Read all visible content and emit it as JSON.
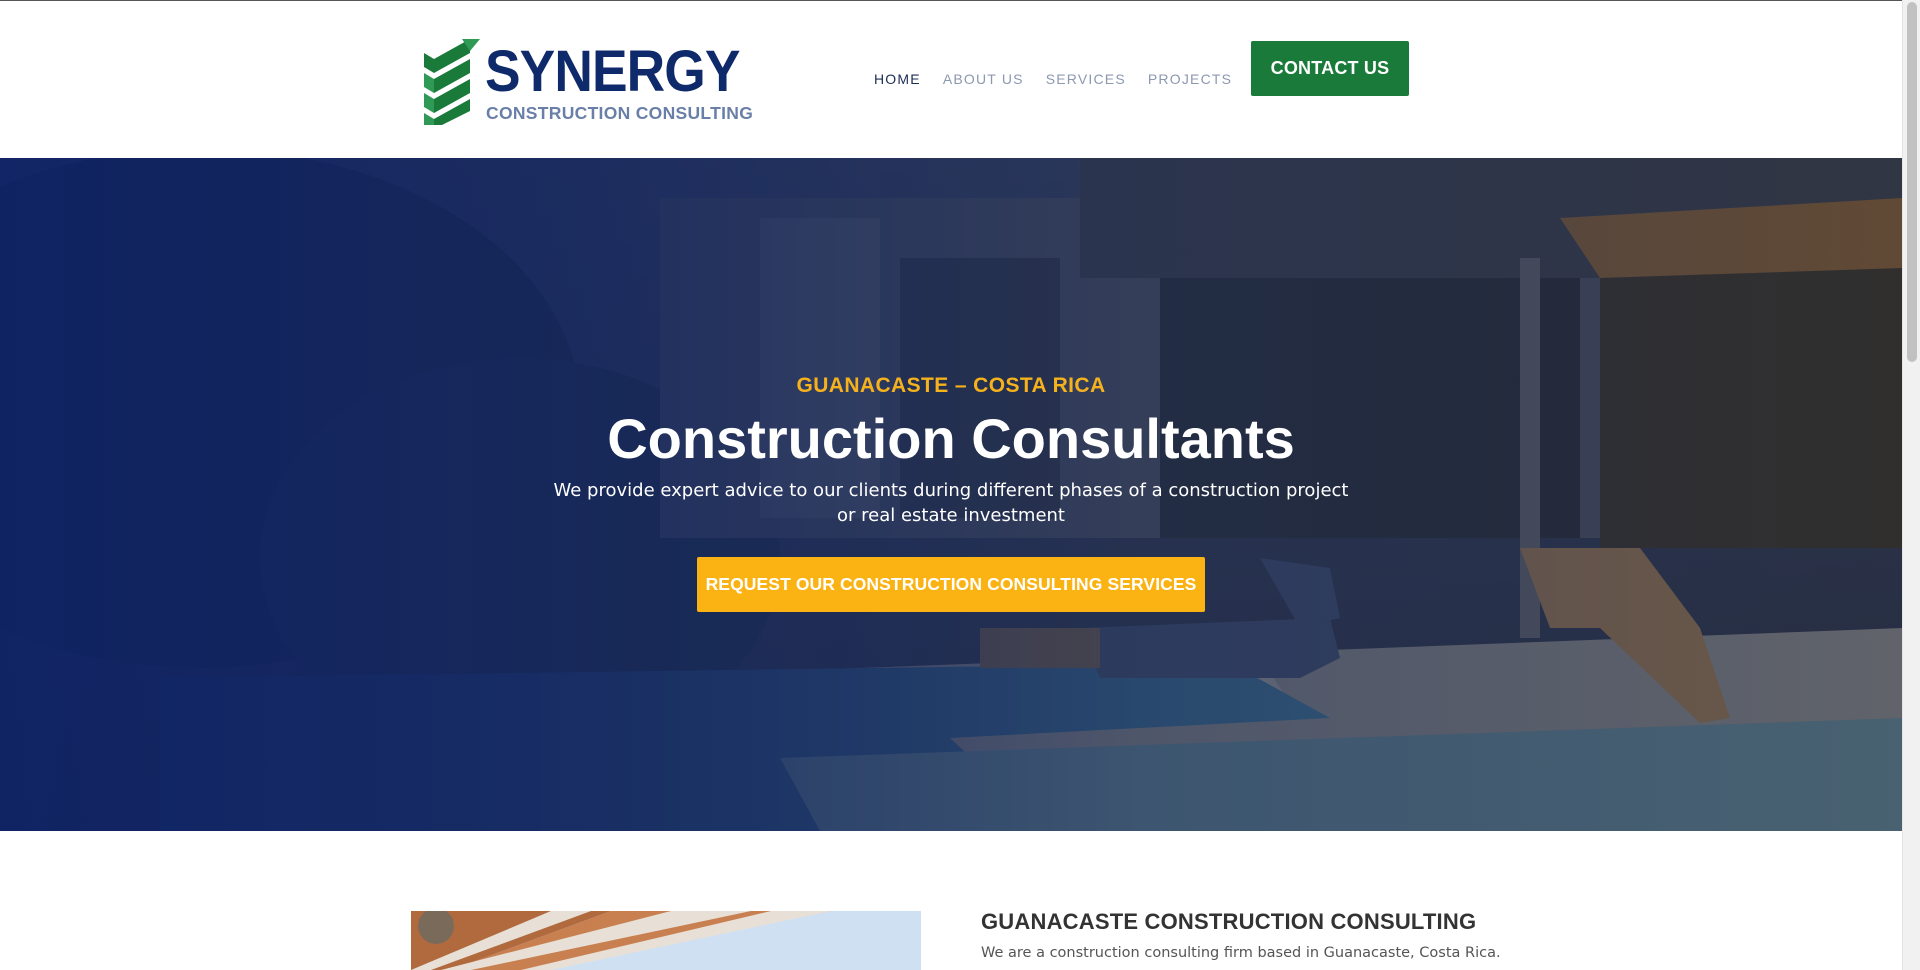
{
  "brand": {
    "name": "SYNERGY",
    "tagline": "CONSTRUCTION CONSULTING",
    "logo_icon": "chevron-stack-logo-icon",
    "colors": {
      "navy": "#0f2a6b",
      "green": "#1a7a3a",
      "yellow": "#fbb314",
      "slate": "#6a7fa8"
    }
  },
  "nav": {
    "items": [
      {
        "label": "HOME",
        "active": true
      },
      {
        "label": "ABOUT US",
        "active": false
      },
      {
        "label": "SERVICES",
        "active": false
      },
      {
        "label": "PROJECTS",
        "active": false
      }
    ],
    "cta_label": "CONTACT US"
  },
  "hero": {
    "kicker": "GUANACASTE – COSTA RICA",
    "title": "Construction Consultants",
    "description_line1": "We provide expert advice to our clients during different phases of a construction project",
    "description_line2": "or real estate investment",
    "cta_label": "REQUEST OUR CONSTRUCTION CONSULTING SERVICES"
  },
  "about": {
    "title": "GUANACASTE CONSTRUCTION CONSULTING",
    "text": "We are a construction consulting firm based in Guanacaste, Costa Rica."
  }
}
